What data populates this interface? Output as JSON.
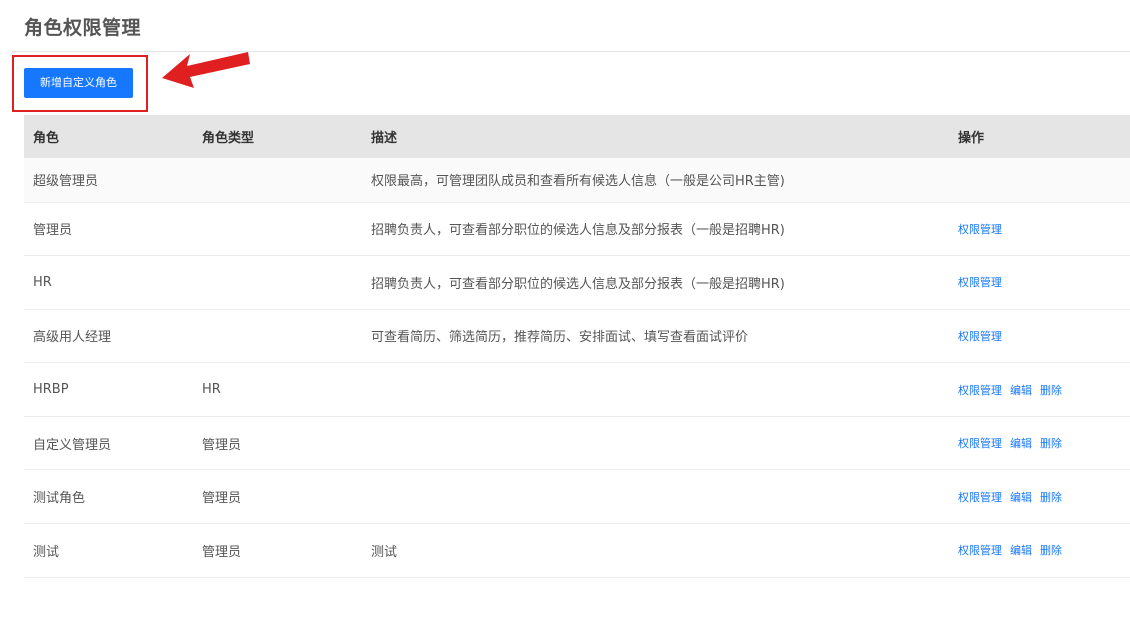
{
  "page": {
    "title": "角色权限管理"
  },
  "toolbar": {
    "add_role_label": "新增自定义角色"
  },
  "table": {
    "headers": [
      "角色",
      "角色类型",
      "描述",
      "操作"
    ],
    "rows": [
      {
        "role": "超级管理员",
        "type": "",
        "desc": "权限最高，可管理团队成员和查看所有候选人信息（一般是公司HR主管)",
        "ops": []
      },
      {
        "role": "管理员",
        "type": "",
        "desc": "招聘负责人，可查看部分职位的候选人信息及部分报表（一般是招聘HR)",
        "ops": [
          "权限管理"
        ]
      },
      {
        "role": "HR",
        "type": "",
        "desc": "招聘负责人，可查看部分职位的候选人信息及部分报表（一般是招聘HR)",
        "ops": [
          "权限管理"
        ]
      },
      {
        "role": "高级用人经理",
        "type": "",
        "desc": "可查看简历、筛选简历，推荐简历、安排面试、填写查看面试评价",
        "ops": [
          "权限管理"
        ]
      },
      {
        "role": "HRBP",
        "type": "HR",
        "desc": "",
        "ops": [
          "权限管理",
          "编辑",
          "删除"
        ]
      },
      {
        "role": "自定义管理员",
        "type": "管理员",
        "desc": "",
        "ops": [
          "权限管理",
          "编辑",
          "删除"
        ]
      },
      {
        "role": "测试角色",
        "type": "管理员",
        "desc": "",
        "ops": [
          "权限管理",
          "编辑",
          "删除"
        ]
      },
      {
        "role": "测试",
        "type": "管理员",
        "desc": "测试",
        "ops": [
          "权限管理",
          "编辑",
          "删除"
        ]
      }
    ]
  },
  "colors": {
    "primary": "#1677ff",
    "highlight": "#e02020",
    "header_bg": "#e5e5e5"
  }
}
